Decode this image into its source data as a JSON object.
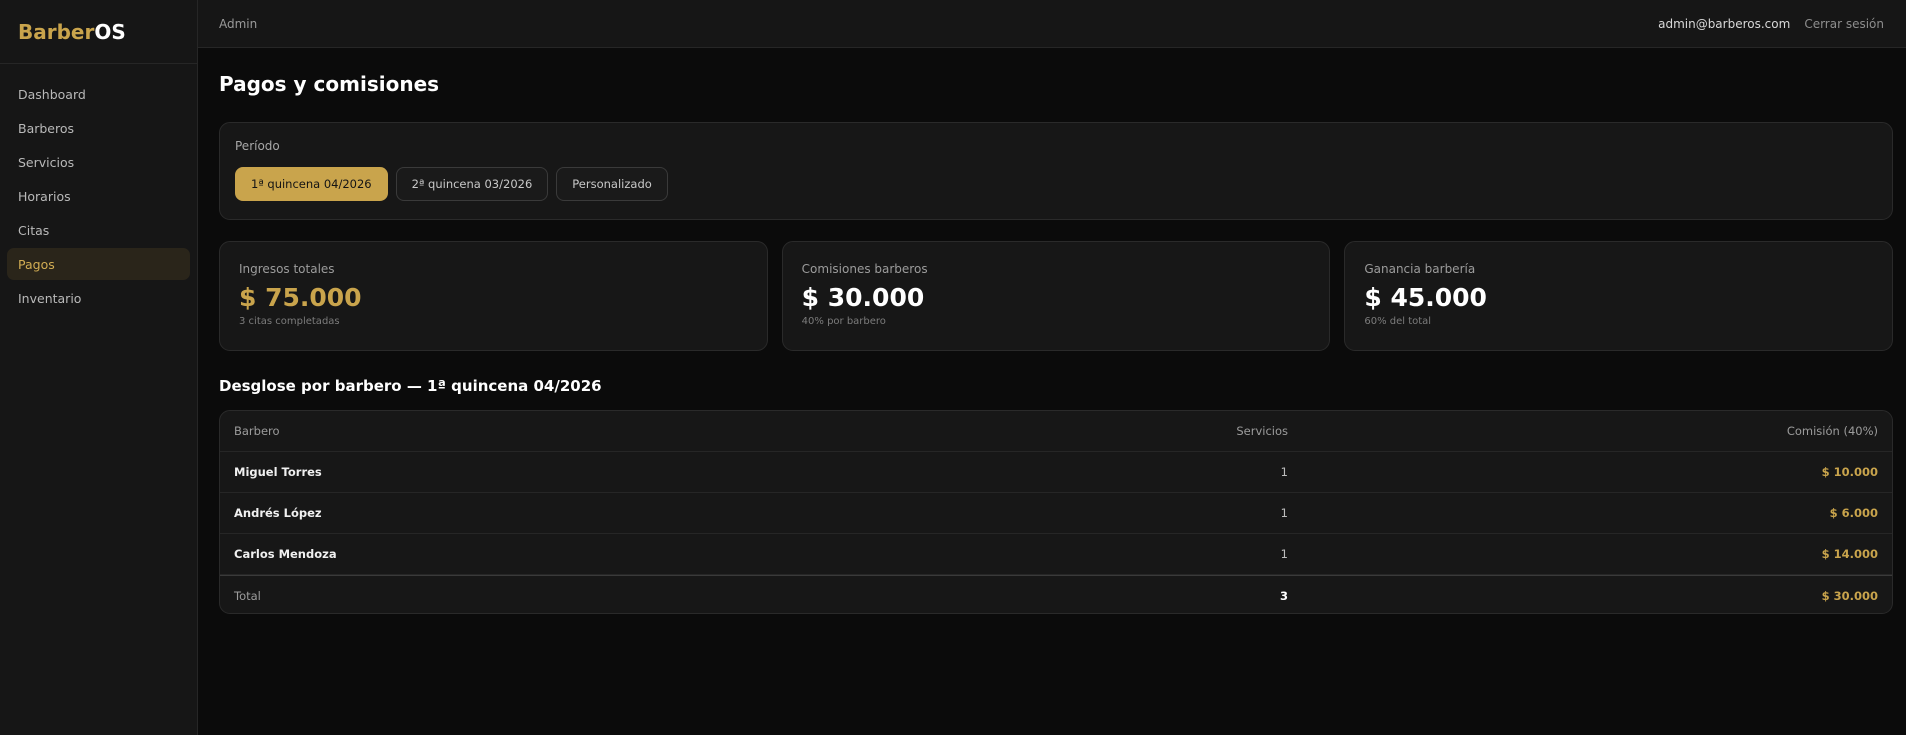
{
  "brand": {
    "part1": "Barber",
    "part2": "OS"
  },
  "sidebar": {
    "items": [
      {
        "label": "Dashboard"
      },
      {
        "label": "Barberos"
      },
      {
        "label": "Servicios"
      },
      {
        "label": "Horarios"
      },
      {
        "label": "Citas"
      },
      {
        "label": "Pagos",
        "active": true
      },
      {
        "label": "Inventario"
      }
    ]
  },
  "topbar": {
    "role": "Admin",
    "email": "admin@barberos.com",
    "logout": "Cerrar sesión"
  },
  "page": {
    "title": "Pagos y comisiones"
  },
  "period": {
    "label": "Período",
    "options": [
      {
        "label": "1ª quincena 04/2026",
        "active": true
      },
      {
        "label": "2ª quincena 03/2026"
      },
      {
        "label": "Personalizado"
      }
    ]
  },
  "stats": [
    {
      "label": "Ingresos totales",
      "value": "$ 75.000",
      "sub": "3 citas completadas"
    },
    {
      "label": "Comisiones barberos",
      "value": "$ 30.000",
      "sub": "40% por barbero"
    },
    {
      "label": "Ganancia barbería",
      "value": "$ 45.000",
      "sub": "60% del total"
    }
  ],
  "breakdown": {
    "title": "Desglose por barbero — 1ª quincena 04/2026",
    "columns": {
      "barber": "Barbero",
      "services": "Servicios",
      "commission": "Comisión (40%)"
    },
    "rows": [
      {
        "barber": "Miguel Torres",
        "services": "1",
        "commission": "$ 10.000"
      },
      {
        "barber": "Andrés López",
        "services": "1",
        "commission": "$ 6.000"
      },
      {
        "barber": "Carlos Mendoza",
        "services": "1",
        "commission": "$ 14.000"
      }
    ],
    "total": {
      "label": "Total",
      "services": "3",
      "commission": "$ 30.000"
    }
  },
  "colors": {
    "accent": "#c9a44c",
    "background": "#0b0b0b",
    "panel": "#171717"
  }
}
